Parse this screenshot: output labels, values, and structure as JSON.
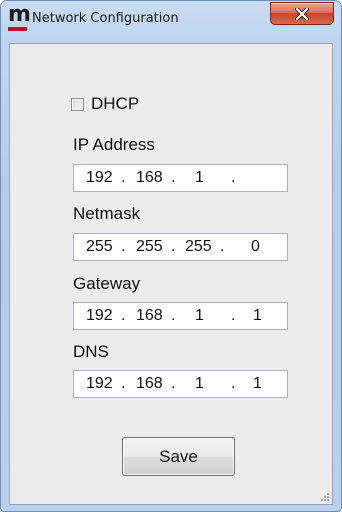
{
  "window": {
    "title": "Network Configuration",
    "logo_letter": "m",
    "close_icon": "close-x-icon"
  },
  "form": {
    "dhcp": {
      "label": "DHCP",
      "checked": false
    },
    "ip_address": {
      "label": "IP Address",
      "octets": [
        "192",
        "168",
        "1",
        ""
      ]
    },
    "netmask": {
      "label": "Netmask",
      "octets": [
        "255",
        "255",
        "255",
        "0"
      ]
    },
    "gateway": {
      "label": "Gateway",
      "octets": [
        "192",
        "168",
        "1",
        "1"
      ]
    },
    "dns": {
      "label": "DNS",
      "octets": [
        "192",
        "168",
        "1",
        "1"
      ]
    },
    "dot": ".",
    "save_label": "Save"
  },
  "colors": {
    "logo_bar": "#b0152a",
    "close_button": "#c7452b"
  }
}
